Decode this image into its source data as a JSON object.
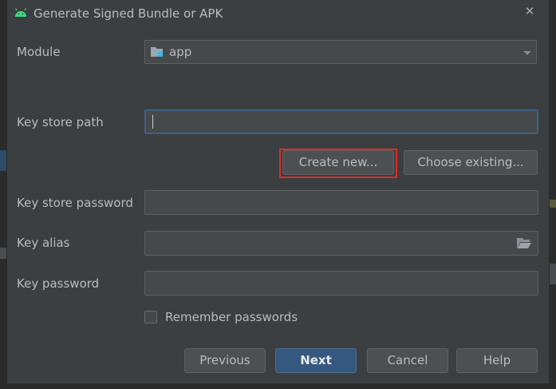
{
  "window": {
    "title": "Generate Signed Bundle or APK",
    "close_glyph": "✕"
  },
  "module": {
    "label": "Module",
    "selected": "app"
  },
  "keystore_path": {
    "label": "Key store path",
    "value": ""
  },
  "buttons": {
    "create_new": "Create new...",
    "choose_existing": "Choose existing...",
    "previous": "Previous",
    "next": "Next",
    "cancel": "Cancel",
    "help": "Help"
  },
  "keystore_password": {
    "label": "Key store password",
    "value": ""
  },
  "key_alias": {
    "label": "Key alias",
    "value": ""
  },
  "key_password": {
    "label": "Key password",
    "value": ""
  },
  "remember": {
    "label": "Remember passwords",
    "checked": false
  },
  "colors": {
    "highlight": "#e02b27",
    "primary_button": "#365880",
    "focus_border": "#3d6185",
    "android_green": "#3ddc84"
  },
  "icons": [
    "android-icon",
    "close-icon",
    "folder-module-icon",
    "chevron-down-icon",
    "browse-folder-icon"
  ]
}
